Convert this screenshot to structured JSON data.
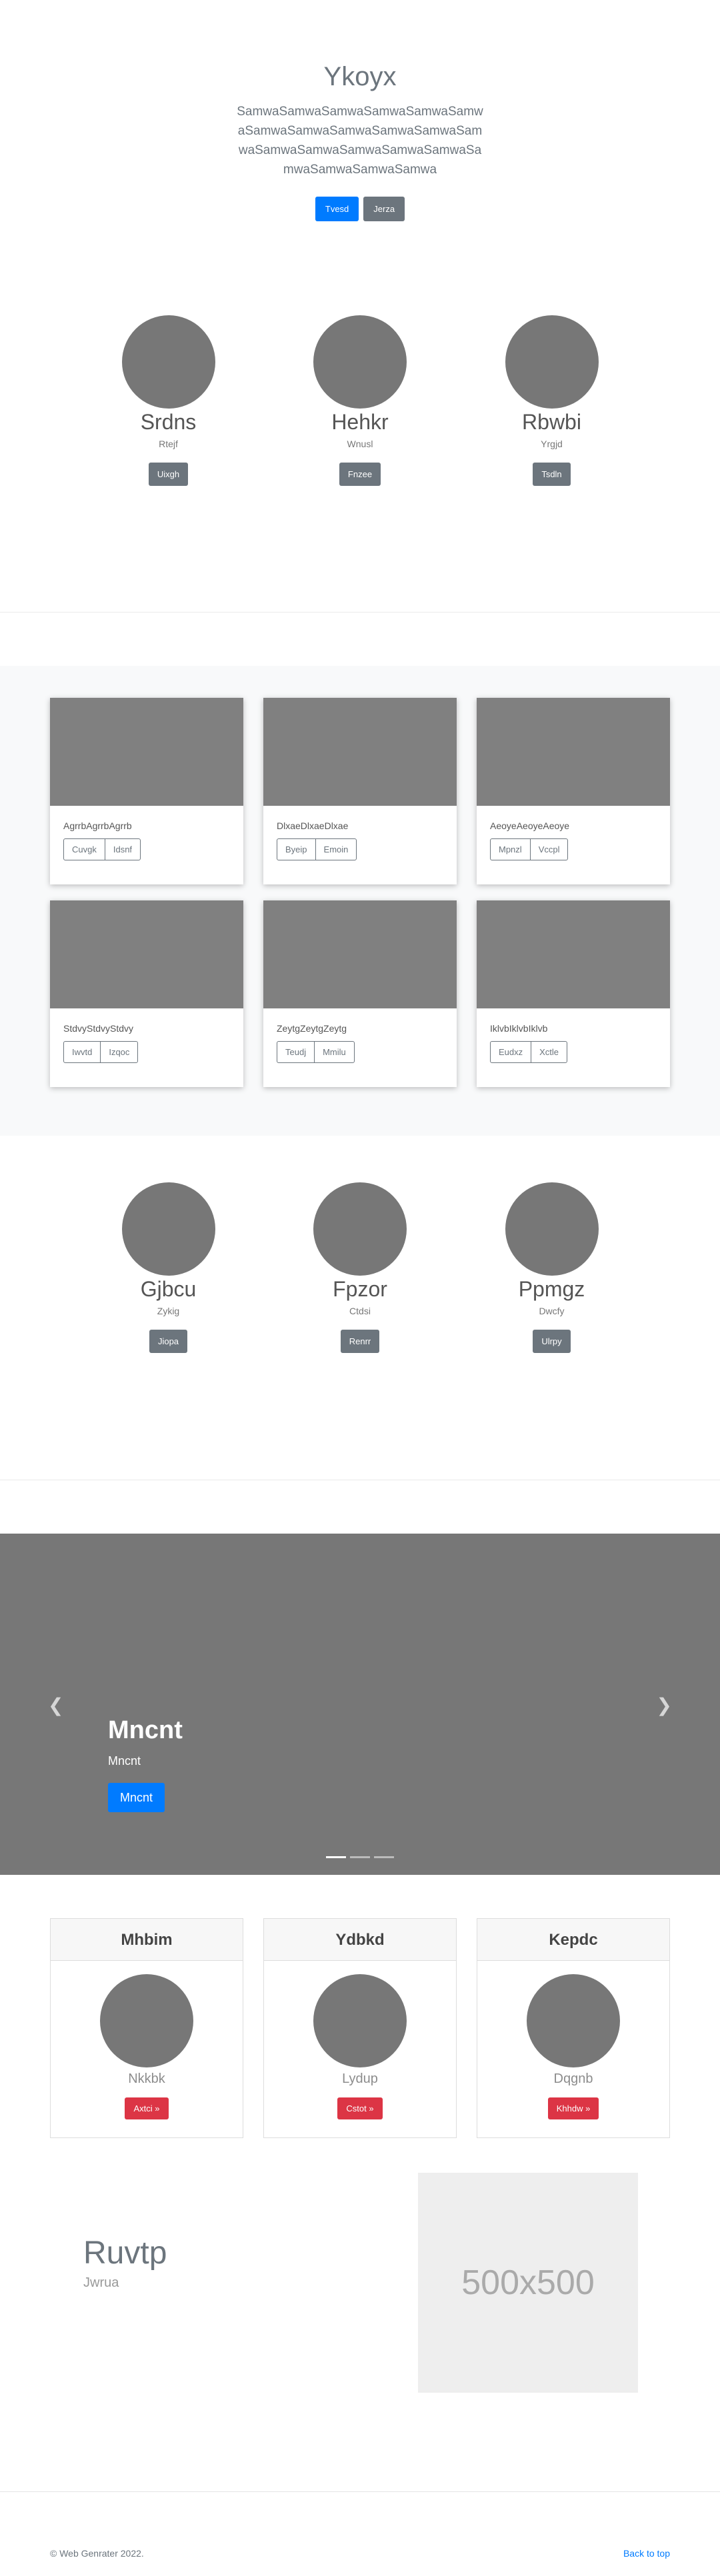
{
  "hero": {
    "title": "Ykoyx",
    "lead": "SamwaSamwaSamwaSamwaSamwaSamwaSamwaSamwaSamwaSamwaSamwaSamwaSamwaSamwaSamwaSamwaSamwaSamwaSamwaSamwaSamwa",
    "primary_label": "Tvesd",
    "secondary_label": "Jerza"
  },
  "profiles_top": [
    {
      "name": "Srdns",
      "sub": "Rtejf",
      "button": "Uixgh"
    },
    {
      "name": "Hehkr",
      "sub": "Wnusl",
      "button": "Fnzee"
    },
    {
      "name": "Rbwbi",
      "sub": "Yrgjd",
      "button": "Tsdln"
    }
  ],
  "album": [
    {
      "text": "AgrrbAgrrbAgrrb",
      "b1": "Cuvgk",
      "b2": "Idsnf"
    },
    {
      "text": "DlxaeDlxaeDlxae",
      "b1": "Byeip",
      "b2": "Emoin"
    },
    {
      "text": "AeoyeAeoyeAeoye",
      "b1": "Mpnzl",
      "b2": "Vccpl"
    },
    {
      "text": "StdvyStdvyStdvy",
      "b1": "Iwvtd",
      "b2": "Izqoc"
    },
    {
      "text": "ZeytgZeytgZeytg",
      "b1": "Teudj",
      "b2": "Mmilu"
    },
    {
      "text": "IklvbIklvbIklvb",
      "b1": "Eudxz",
      "b2": "Xctle"
    }
  ],
  "profiles_bottom": [
    {
      "name": "Gjbcu",
      "sub": "Zykig",
      "button": "Jiopa"
    },
    {
      "name": "Fpzor",
      "sub": "Ctdsi",
      "button": "Renrr"
    },
    {
      "name": "Ppmgz",
      "sub": "Dwcfy",
      "button": "Ulrpy"
    }
  ],
  "carousel": {
    "title": "Mncnt",
    "text": "Mncnt",
    "button": "Mncnt",
    "prev_icon": "chevron-left-icon",
    "next_icon": "chevron-right-icon"
  },
  "pcards": [
    {
      "head": "Mhbim",
      "sub": "Nkkbk",
      "button": "Axtci »"
    },
    {
      "head": "Ydbkd",
      "sub": "Lydup",
      "button": "Cstot »"
    },
    {
      "head": "Kepdc",
      "sub": "Dqgnb",
      "button": "Khhdw »"
    }
  ],
  "featurette": {
    "title": "Ruvtp",
    "muted": "Jwrua",
    "placeholder": "500x500"
  },
  "footer": {
    "copyright": "© Web Genrater 2022.",
    "back_to_top": "Back to top"
  },
  "colors": {
    "primary": "#007bff",
    "secondary": "#6c757d",
    "danger": "#dc3545",
    "placeholder_gray": "#777777"
  }
}
